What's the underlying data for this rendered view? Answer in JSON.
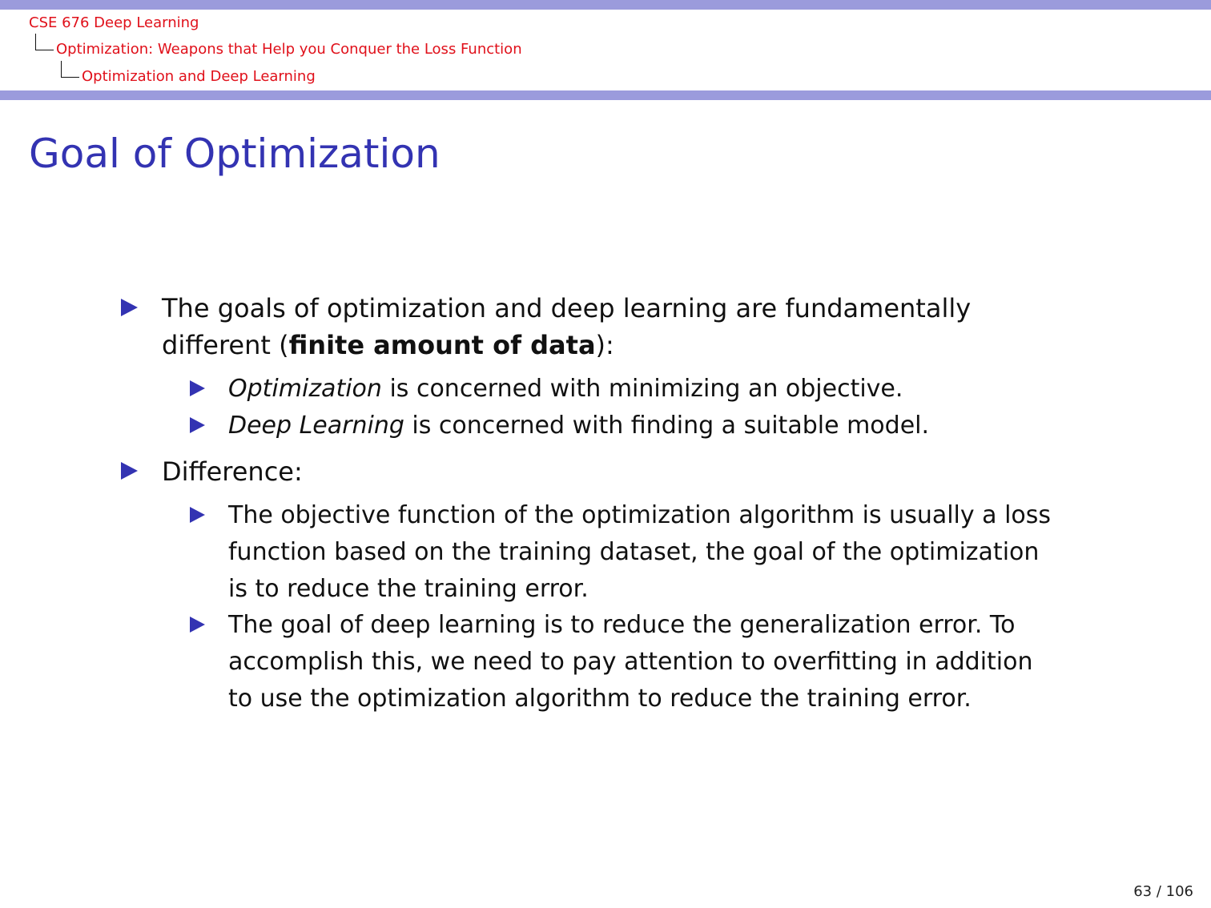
{
  "header": {
    "course": "CSE 676 Deep Learning",
    "section": "Optimization: Weapons that Help you Conquer the Loss Function",
    "subsection": "Optimization and Deep Learning"
  },
  "slide": {
    "title": "Goal of Optimization",
    "bullets": [
      {
        "line1": "The goals of optimization and deep learning are fundamentally",
        "line2_pre": "different (",
        "line2_bold": "finite amount of data",
        "line2_post": "):",
        "subs": [
          {
            "em": "Optimization",
            "rest": " is concerned with minimizing an objective."
          },
          {
            "em": "Deep Learning",
            "rest": " is concerned with finding a suitable model."
          }
        ]
      },
      {
        "text": "Difference:",
        "subs": [
          {
            "lines": [
              "The objective function of the optimization algorithm is usually a loss",
              "function based on the training dataset, the goal of the optimization",
              "is to reduce the training error."
            ]
          },
          {
            "lines": [
              "The goal of deep learning is to reduce the generalization error.  To",
              "accomplish this, we need to pay attention to overfitting in addition",
              "to use the optimization algorithm to reduce the training error."
            ]
          }
        ]
      }
    ]
  },
  "footer": {
    "page": "63 / 106"
  },
  "colors": {
    "band": "#9b9bdc",
    "title": "#3333b2",
    "crumb": "#e0101a",
    "bullet": "#3333b2"
  }
}
